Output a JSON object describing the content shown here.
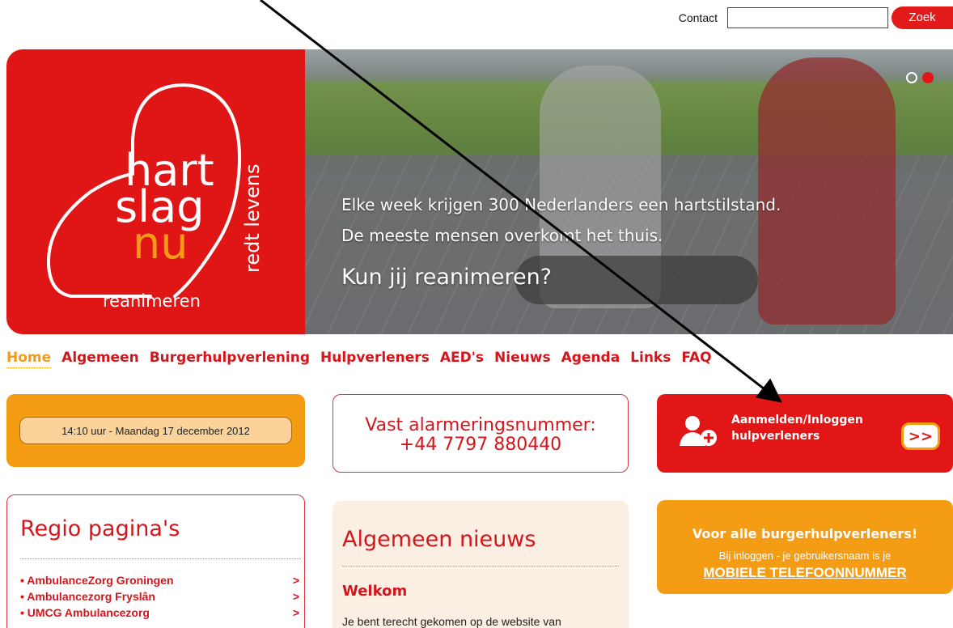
{
  "topbar": {
    "contact_label": "Contact",
    "search_value": "",
    "search_button_label": "Zoek"
  },
  "hero": {
    "logo": {
      "word1": "hart",
      "word2": "slag",
      "word3": "nu",
      "vertical_tagline": "redt levens",
      "bottom_text": "reanimeren"
    },
    "line1": "Elke week krijgen 300 Nederlanders een hartstilstand.",
    "line2": "De meeste mensen overkomt het thuis.",
    "line3": "Kun jij reanimeren?",
    "slides_total": 2,
    "active_slide": 2
  },
  "nav": {
    "items": [
      {
        "label": "Home",
        "active": true
      },
      {
        "label": "Algemeen"
      },
      {
        "label": "Burgerhulpverlening"
      },
      {
        "label": "Hulpverleners"
      },
      {
        "label": "AED's"
      },
      {
        "label": "Nieuws"
      },
      {
        "label": "Agenda"
      },
      {
        "label": "Links"
      },
      {
        "label": "FAQ"
      }
    ]
  },
  "datebox": {
    "text": "14:10 uur - Maandag 17 december 2012"
  },
  "alarm": {
    "line1": "Vast alarmeringsnummer:",
    "line2": "+44 7797 880440"
  },
  "login": {
    "line1": "Aanmelden/Inloggen",
    "line2": "hulpverleners",
    "go_label": ">>"
  },
  "regio": {
    "title": "Regio pagina's",
    "items": [
      {
        "label": "• AmbulanceZorg Groningen",
        "arrow": ">"
      },
      {
        "label": "• Ambulancezorg Fryslân",
        "arrow": ">"
      },
      {
        "label": "• UMCG Ambulancezorg",
        "arrow": ">"
      }
    ]
  },
  "news": {
    "title": "Algemeen nieuws",
    "subtitle": "Welkom",
    "text": "Je bent terecht gekomen op de website van"
  },
  "burger": {
    "title": "Voor alle burgerhulpverleners!",
    "text": "Bij inloggen -  je gebruikersnaam is je",
    "link": "MOBIELE TELEFOONNUMMER"
  },
  "colors": {
    "brand_red": "#e21616",
    "brand_orange": "#f39c14"
  }
}
